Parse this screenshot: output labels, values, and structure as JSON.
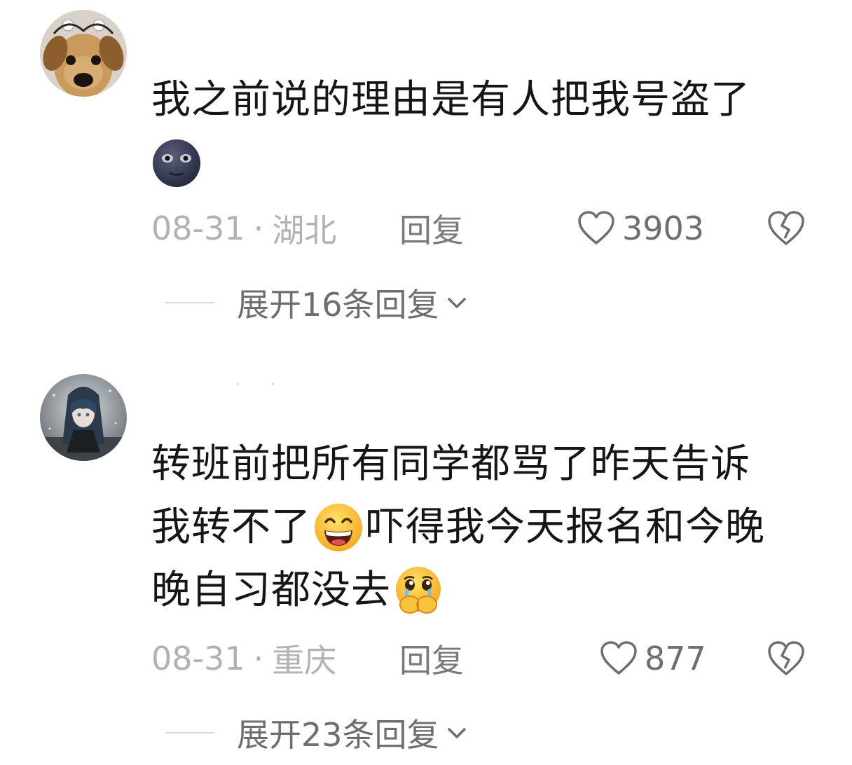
{
  "comments": [
    {
      "username": "",
      "avatar_icon": "dog-avatar-icon",
      "text_lines": [
        {
          "parts": [
            {
              "type": "text",
              "value": "我之前说的理由是有人把我号盗了"
            }
          ]
        },
        {
          "parts": [
            {
              "type": "emoji",
              "name": "new-moon-face-emoji"
            }
          ]
        }
      ],
      "date": "08-31",
      "separator": "·",
      "location": "湖北",
      "reply_label": "回复",
      "likes": "3903",
      "expand_label": "展开16条回复"
    },
    {
      "username": "· ·",
      "avatar_icon": "anime-girl-avatar-icon",
      "text_lines": [
        {
          "parts": [
            {
              "type": "text",
              "value": "转班前把所有同学都骂了昨天告诉"
            }
          ]
        },
        {
          "parts": [
            {
              "type": "text",
              "value": "我转不了"
            },
            {
              "type": "emoji",
              "name": "grinning-face-emoji"
            },
            {
              "type": "text",
              "value": "吓得我今天报名和今晚"
            }
          ]
        },
        {
          "parts": [
            {
              "type": "text",
              "value": "晚自习都没去"
            },
            {
              "type": "emoji",
              "name": "crying-hands-over-mouth-emoji"
            }
          ]
        }
      ],
      "date": "08-31",
      "separator": "·",
      "location": "重庆",
      "reply_label": "回复",
      "likes": "877",
      "expand_label": "展开23条回复"
    }
  ],
  "colors": {
    "text": "#161616",
    "meta_gray": "#b2b2b2",
    "action_gray": "#6e6e6e",
    "background": "#ffffff"
  }
}
